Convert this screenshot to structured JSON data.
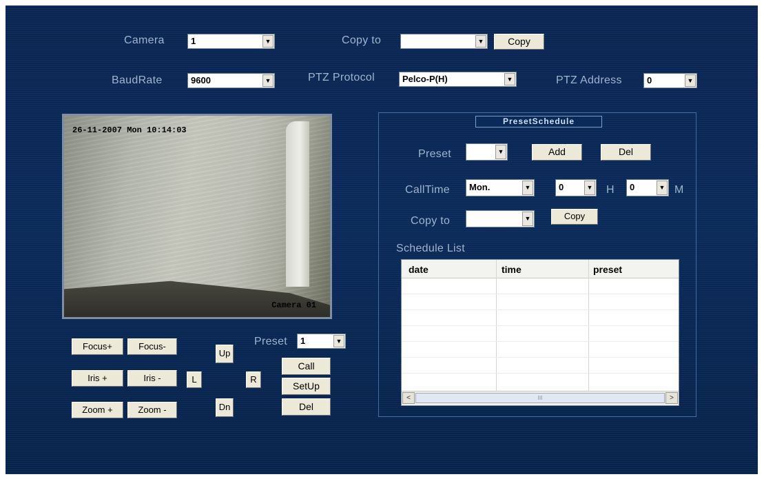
{
  "top": {
    "camera_label": "Camera",
    "camera_value": "1",
    "copy_to_label": "Copy to",
    "copy_to_value": "",
    "copy_button": "Copy",
    "baudrate_label": "BaudRate",
    "baudrate_value": "9600",
    "ptz_protocol_label": "PTZ Protocol",
    "ptz_protocol_value": "Pelco-P(H)",
    "ptz_address_label": "PTZ Address",
    "ptz_address_value": "0"
  },
  "video": {
    "timestamp": "26-11-2007 Mon 10:14:03",
    "camera_name": "Camera 01"
  },
  "ptz_controls": {
    "focus_plus": "Focus+",
    "focus_minus": "Focus-",
    "iris_plus": "Iris +",
    "iris_minus": "Iris -",
    "zoom_plus": "Zoom +",
    "zoom_minus": "Zoom -",
    "up": "Up",
    "down": "Dn",
    "left": "L",
    "right": "R",
    "preset_label": "Preset",
    "preset_value": "1",
    "call": "Call",
    "setup": "SetUp",
    "del": "Del"
  },
  "preset_schedule": {
    "title": "PresetSchedule",
    "preset_label": "Preset",
    "preset_value": "",
    "add_button": "Add",
    "del_button": "Del",
    "calltime_label": "CallTime",
    "day_value": "Mon.",
    "hour_value": "0",
    "hour_unit": "H",
    "minute_value": "0",
    "minute_unit": "M",
    "copy_to_label": "Copy to",
    "copy_to_value": "",
    "copy_button": "Copy",
    "schedule_list_label": "Schedule List",
    "columns": [
      "date",
      "time",
      "preset"
    ],
    "scroll_thumb": "III"
  },
  "icons": {
    "dropdown_arrow": "▼",
    "scroll_left": "<",
    "scroll_right": ">"
  }
}
